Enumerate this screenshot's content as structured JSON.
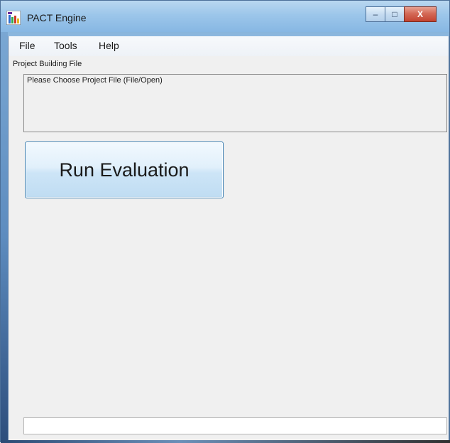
{
  "window": {
    "title": "PACT Engine",
    "app_icon": "pact-app-icon",
    "caption_buttons": {
      "minimize_glyph": "–",
      "maximize_glyph": "□",
      "close_glyph": "X"
    }
  },
  "menubar": {
    "items": [
      {
        "label": "File"
      },
      {
        "label": "Tools"
      },
      {
        "label": "Help"
      }
    ]
  },
  "main": {
    "project_label": "Project Building File",
    "file_box_text": "Please Choose Project File (File/Open)",
    "run_button_label": "Run Evaluation",
    "status_text": ""
  },
  "colors": {
    "client_background": "#f0f0f0",
    "button_border": "#3c7fb1",
    "close_button": "#c34330"
  }
}
